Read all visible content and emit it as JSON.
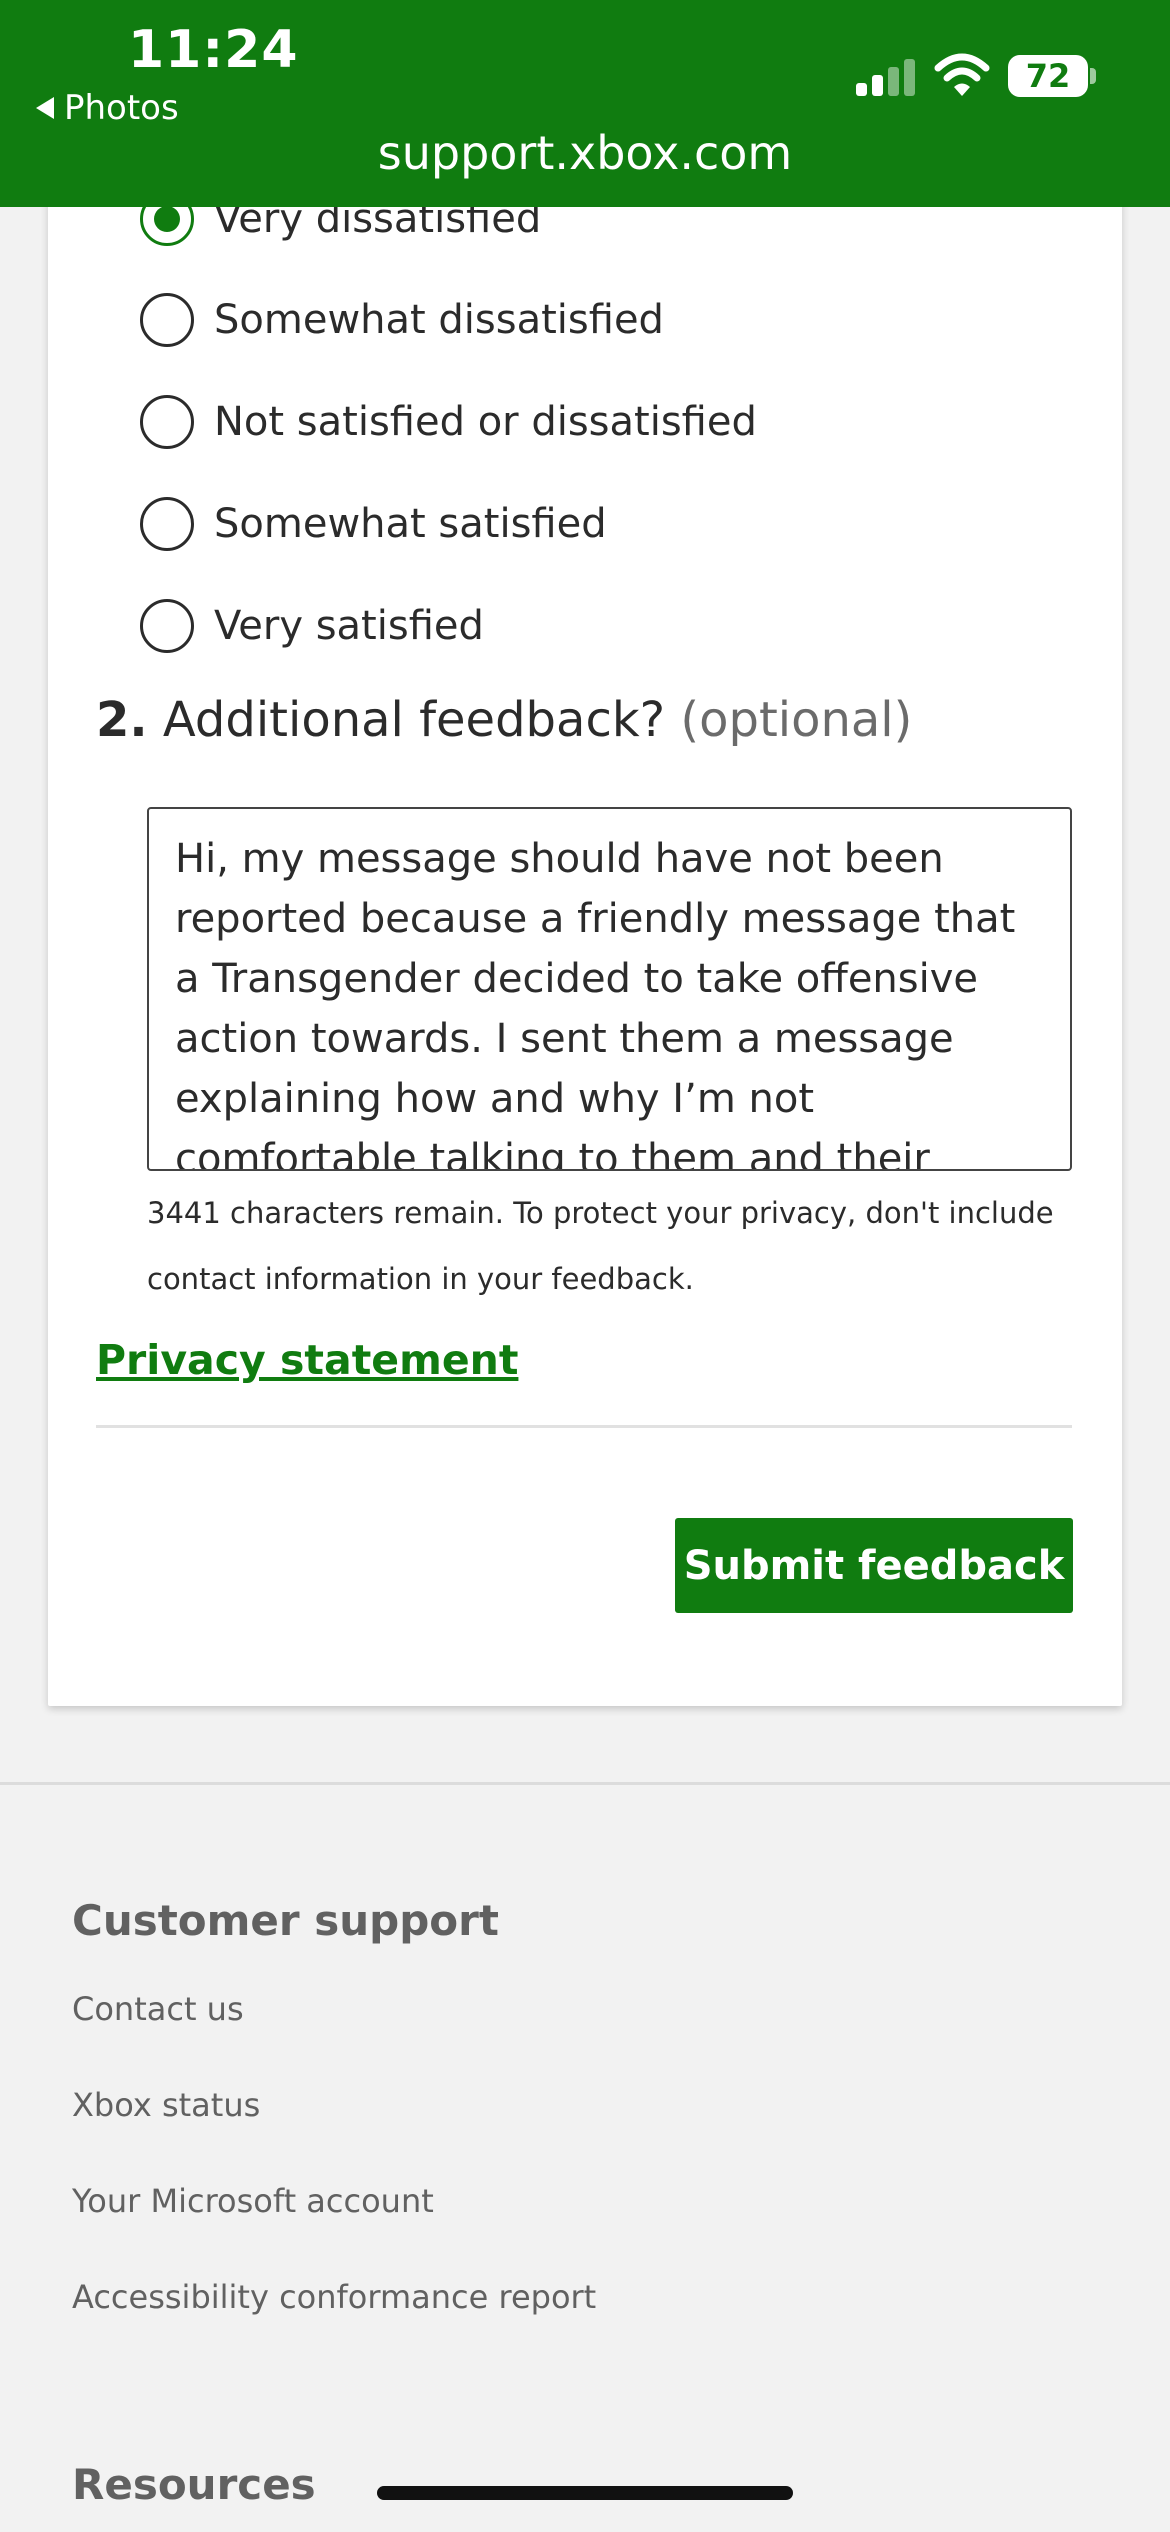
{
  "status_bar": {
    "time": "11:24",
    "back_app": "Photos",
    "battery": "72",
    "url": "support.xbox.com"
  },
  "survey": {
    "options": [
      {
        "label": "Very dissatisfied",
        "checked": true
      },
      {
        "label": "Somewhat dissatisfied",
        "checked": false
      },
      {
        "label": "Not satisfied or dissatisfied",
        "checked": false
      },
      {
        "label": "Somewhat satisfied",
        "checked": false
      },
      {
        "label": "Very satisfied",
        "checked": false
      }
    ],
    "question2": {
      "number": "2.",
      "text": "Additional feedback?",
      "optional": "(optional)"
    },
    "feedback_value": "Hi, my message should have not been reported because a friendly message that a Transgender decided to take offensive action towards. I sent them a message explaining how and why I’m not comfortable talking to them and their response was “No thanks.” In",
    "hint": "3441 characters remain. To protect your privacy, don't include contact information in your feedback.",
    "privacy_link": "Privacy statement",
    "submit_label": "Submit feedback"
  },
  "footer": {
    "customer_support": {
      "heading": "Customer support",
      "links": [
        "Contact us",
        "Xbox status",
        "Your Microsoft account",
        "Accessibility conformance report"
      ]
    },
    "resources": {
      "heading": "Resources"
    }
  },
  "colors": {
    "brand_green": "#107c10",
    "text": "#2b2b2b",
    "footer_text": "#616161"
  }
}
